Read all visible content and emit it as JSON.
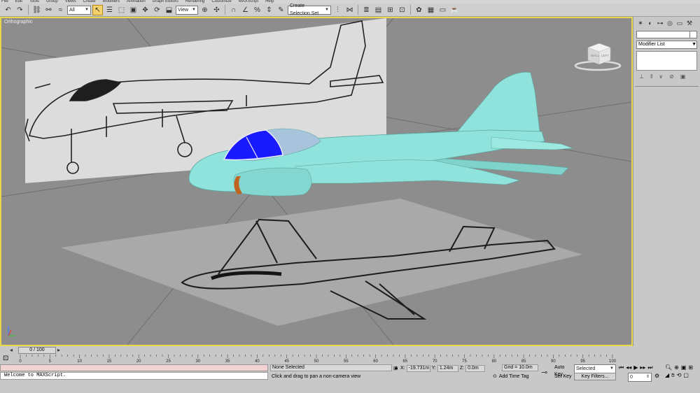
{
  "menu": [
    "File",
    "Edit",
    "Tools",
    "Group",
    "Views",
    "Create",
    "Modifiers",
    "Animation",
    "Graph Editors",
    "Rendering",
    "Customize",
    "MAXScript",
    "Help"
  ],
  "toolbar": {
    "selection_filter": "All",
    "reference_coord": "View",
    "named_selection": "Create Selection Set"
  },
  "viewport": {
    "label": "Orthographic",
    "viewcube_left": "LEFT",
    "viewcube_wall": "WALL",
    "colors": {
      "background": "#8d8d8d",
      "border": "#e8d84a",
      "model_body": "#8fe3dc",
      "canopy": "#1a1aff",
      "blueprint_plane": "#dcdcdc",
      "floor_plane": "#a9a9a9"
    }
  },
  "cmdpanel": {
    "modifier_list": "Modifier List"
  },
  "time": {
    "slider_label": "0 / 100",
    "ticks": [
      0,
      5,
      10,
      15,
      20,
      25,
      30,
      35,
      40,
      45,
      50,
      55,
      60,
      65,
      70,
      75,
      80,
      85,
      90,
      95,
      100
    ]
  },
  "status": {
    "listener_text": "Welcome to MAXScript.",
    "selection": "None Selected",
    "prompt": "Click and drag to pan a non-camera view",
    "x_label": "X:",
    "x_value": "-19.731m",
    "y_label": "Y:",
    "y_value": "1.24m",
    "z_label": "Z:",
    "z_value": "0.0m",
    "grid": "Grid = 10.0m",
    "add_time_tag": "Add Time Tag",
    "auto_key": "Auto Key",
    "set_key": "Set Key",
    "selected_combo": "Selected",
    "key_filters": "Key Filters...",
    "frame": "0"
  }
}
